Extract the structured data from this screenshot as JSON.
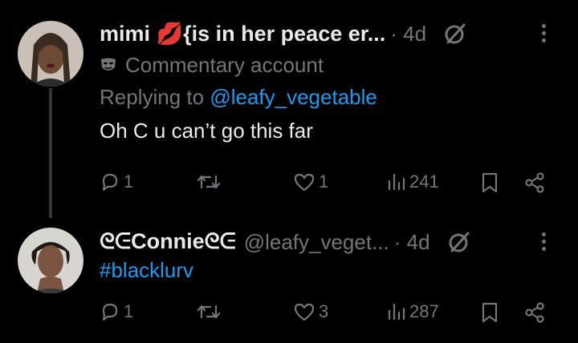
{
  "tweets": [
    {
      "display_name": "mimi 💋{is in her peace er...",
      "handle": "",
      "time": "· 4d",
      "label": "Commentary account",
      "replying_prefix": "Replying to ",
      "replying_mention": "@leafy_vegetable",
      "text": "Oh C u can’t go this far",
      "hashtag": "",
      "stats": {
        "replies": "1",
        "reposts": "",
        "likes": "1",
        "views": "241"
      },
      "icons": [
        "avatar",
        "grok-icon",
        "more-icon",
        "mask-icon",
        "reply-icon",
        "repost-icon",
        "like-icon",
        "views-icon",
        "bookmark-icon",
        "share-icon"
      ]
    },
    {
      "display_name": "ᘓᕮConnieᘓᕮ",
      "handle": "@leafy_veget...",
      "time": "· 4d",
      "label": "",
      "text": "",
      "hashtag": "#blacklurv",
      "stats": {
        "replies": "1",
        "reposts": "",
        "likes": "3",
        "views": "287"
      }
    }
  ],
  "colors": {
    "background": "#000000",
    "text": "#e7e9ea",
    "muted": "#71767b",
    "link": "#1d9bf0"
  }
}
